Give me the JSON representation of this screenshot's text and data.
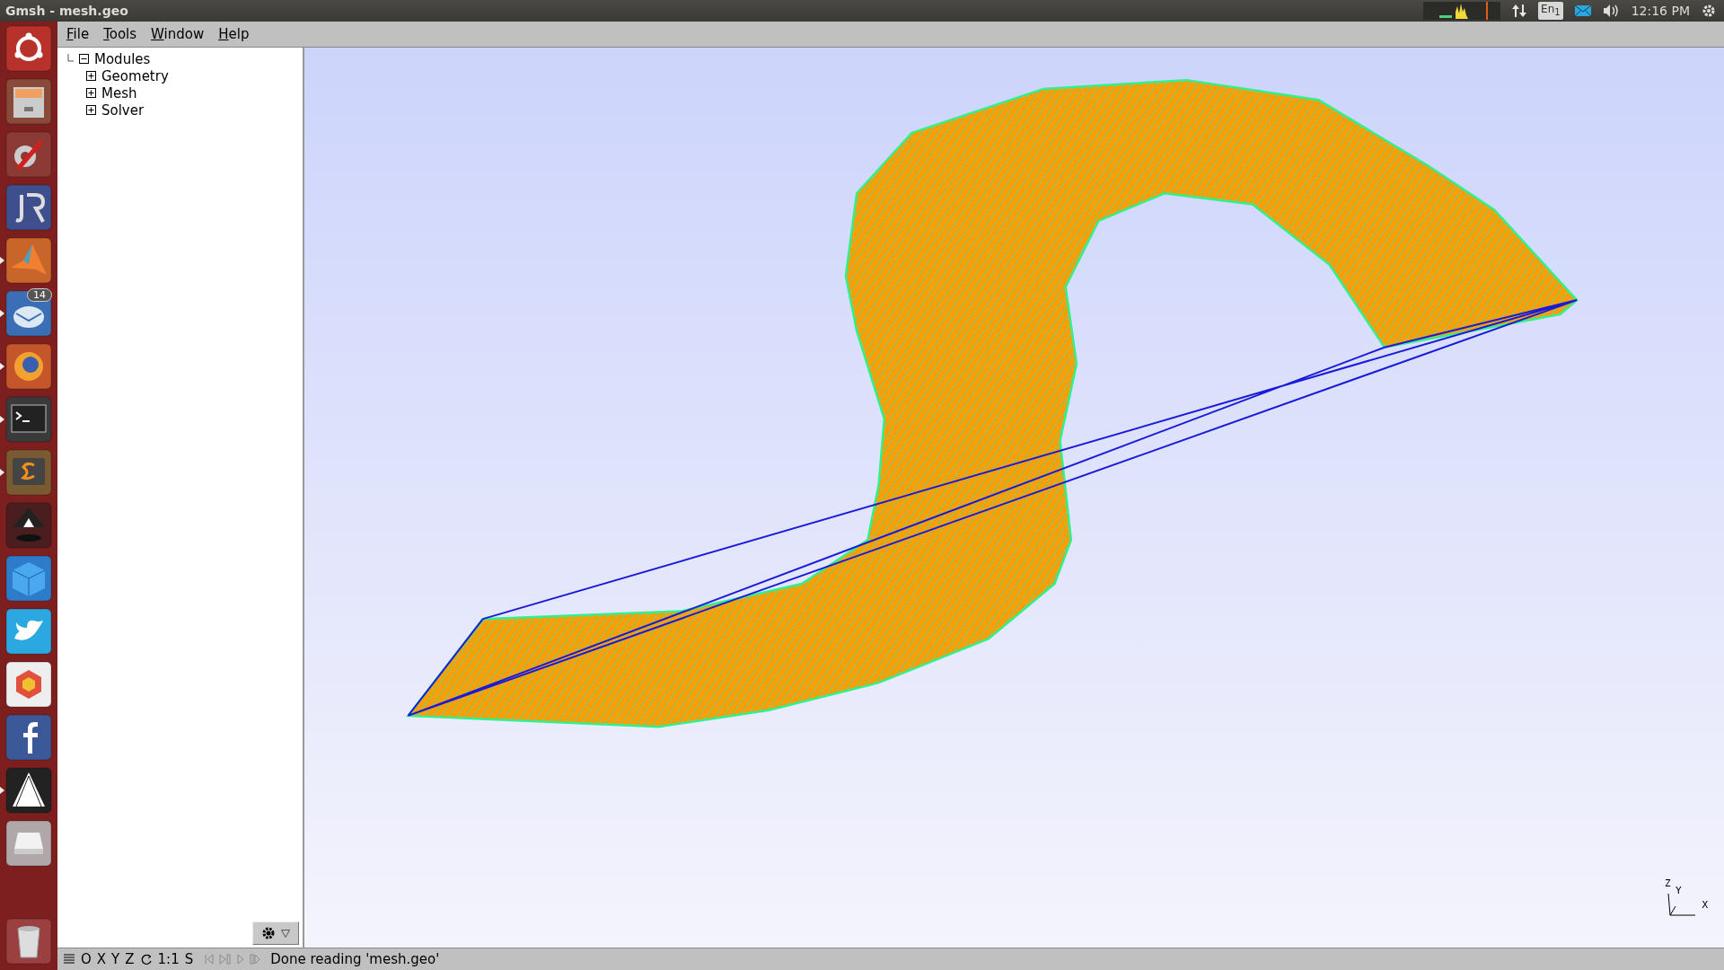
{
  "window": {
    "title": "Gmsh - mesh.geo"
  },
  "system_tray": {
    "keyboard": "En$_{1}$",
    "time": "12:16 PM"
  },
  "launcher": {
    "items": [
      {
        "kind": "ubuntu",
        "running": false
      },
      {
        "kind": "files",
        "running": false
      },
      {
        "kind": "settings",
        "running": false
      },
      {
        "kind": "jr",
        "running": false
      },
      {
        "kind": "matlab",
        "running": true
      },
      {
        "kind": "mail",
        "running": true,
        "badge": "14"
      },
      {
        "kind": "firefox",
        "running": true
      },
      {
        "kind": "terminal",
        "running": true
      },
      {
        "kind": "sublime",
        "running": true
      },
      {
        "kind": "inkscape",
        "running": false
      },
      {
        "kind": "vbox",
        "running": false
      },
      {
        "kind": "twitter",
        "running": false
      },
      {
        "kind": "hexagon",
        "running": false
      },
      {
        "kind": "facebook",
        "running": false
      },
      {
        "kind": "gmsh",
        "running": true
      },
      {
        "kind": "drive",
        "running": false
      }
    ],
    "trash": {
      "kind": "trash"
    }
  },
  "menu": [
    "File",
    "Tools",
    "Window",
    "Help"
  ],
  "tree": {
    "label": "Modules",
    "expanded": true,
    "children": [
      {
        "label": "Geometry",
        "expanded": false
      },
      {
        "label": "Mesh",
        "expanded": false
      },
      {
        "label": "Solver",
        "expanded": false
      }
    ]
  },
  "status_bar": {
    "views": [
      "O",
      "X",
      "Y",
      "Z"
    ],
    "scale": "1:1",
    "s": "S",
    "message": "Done reading 'mesh.geo'"
  },
  "axes": {
    "z": "Z",
    "y": "Y",
    "x": "X"
  }
}
